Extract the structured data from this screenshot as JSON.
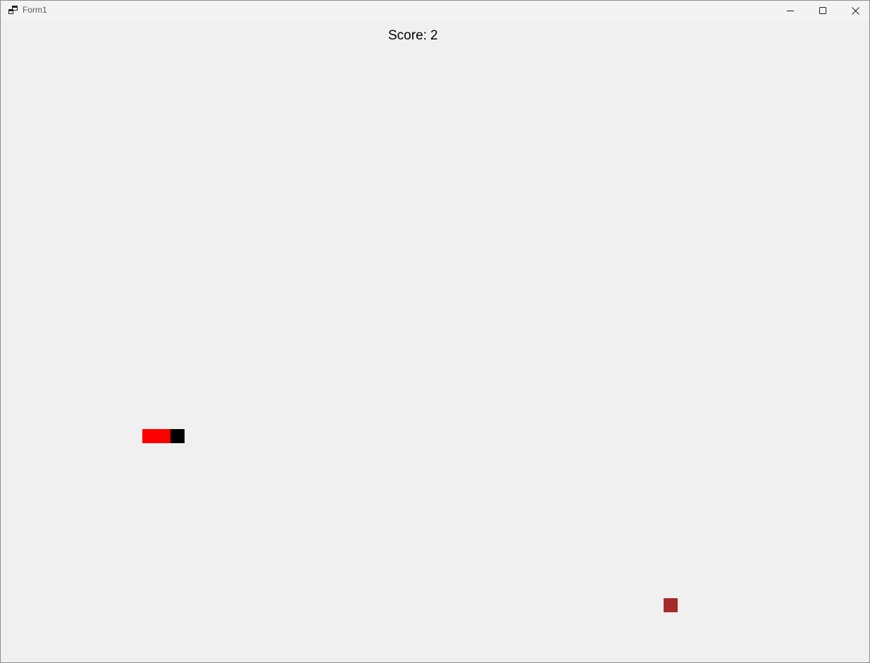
{
  "window": {
    "title": "Form1",
    "app_icon": "winforms-app-icon",
    "buttons": {
      "minimize_icon": "minimize-icon",
      "maximize_icon": "maximize-icon",
      "close_icon": "close-icon"
    }
  },
  "game": {
    "score_label": "Score:",
    "score_value": "2",
    "colors": {
      "background": "#f0f0f0",
      "snake_head": "#000000",
      "snake_body": "#ff0000",
      "food": "#a52a2a"
    }
  }
}
